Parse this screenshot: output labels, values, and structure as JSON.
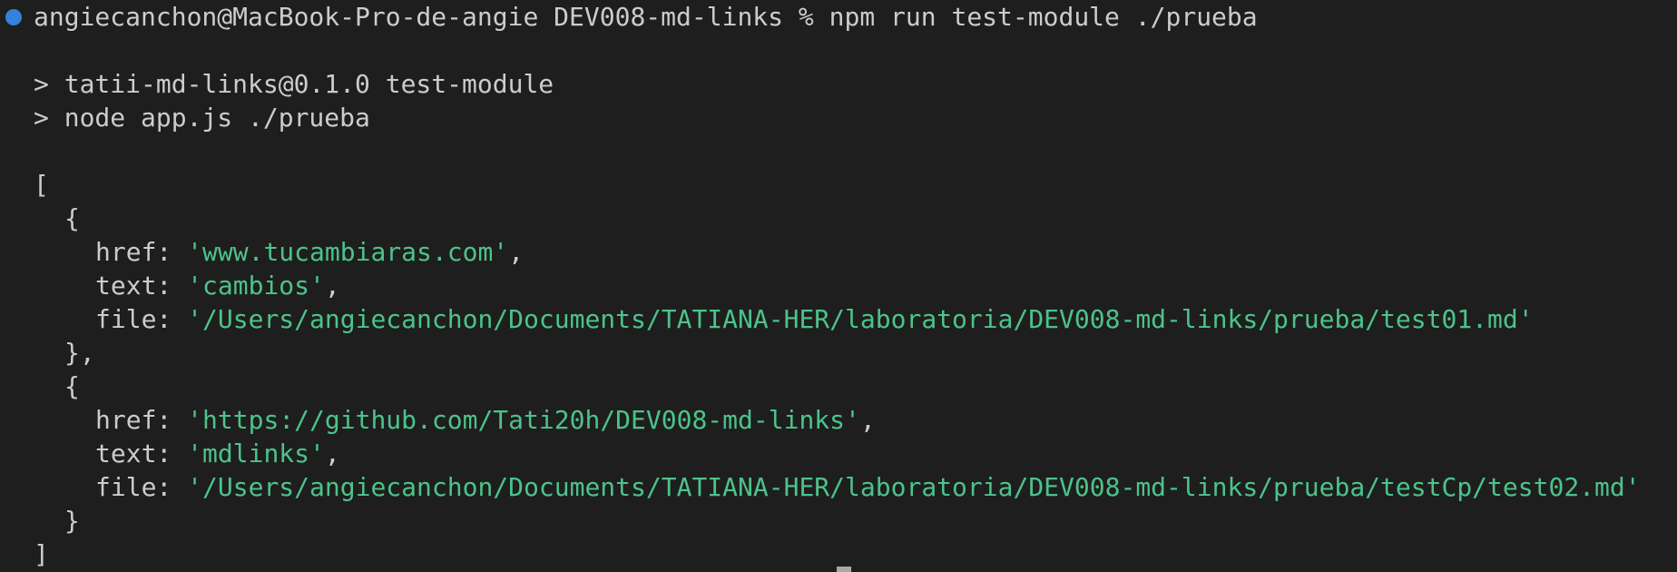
{
  "terminal": {
    "prompt": {
      "user_host": "angiecanchon@MacBook-Pro-de-angie",
      "cwd": "DEV008-md-links",
      "symbol": "%",
      "command": "npm run test-module ./prueba"
    },
    "npm_output": [
      "> tatii-md-links@0.1.0 test-module",
      "> node app.js ./prueba"
    ],
    "result": {
      "open_bracket": "[",
      "close_bracket": "]",
      "entries": [
        {
          "open": "{",
          "close": "},",
          "href_key": "href:",
          "href": "'www.tucambiaras.com'",
          "text_key": "text:",
          "text": "'cambios'",
          "file_key": "file:",
          "file": "'/Users/angiecanchon/Documents/TATIANA-HER/laboratoria/DEV008-md-links/prueba/test01.md'"
        },
        {
          "open": "{",
          "close": "}",
          "href_key": "href:",
          "href": "'https://github.com/Tati20h/DEV008-md-links'",
          "text_key": "text:",
          "text": "'mdlinks'",
          "file_key": "file:",
          "file": "'/Users/angiecanchon/Documents/TATIANA-HER/laboratoria/DEV008-md-links/prueba/testCp/test02.md'"
        }
      ]
    },
    "colors": {
      "background": "#1e1e1e",
      "foreground": "#cccccc",
      "string": "#4cc38a",
      "status_dot": "#3794ff"
    }
  }
}
